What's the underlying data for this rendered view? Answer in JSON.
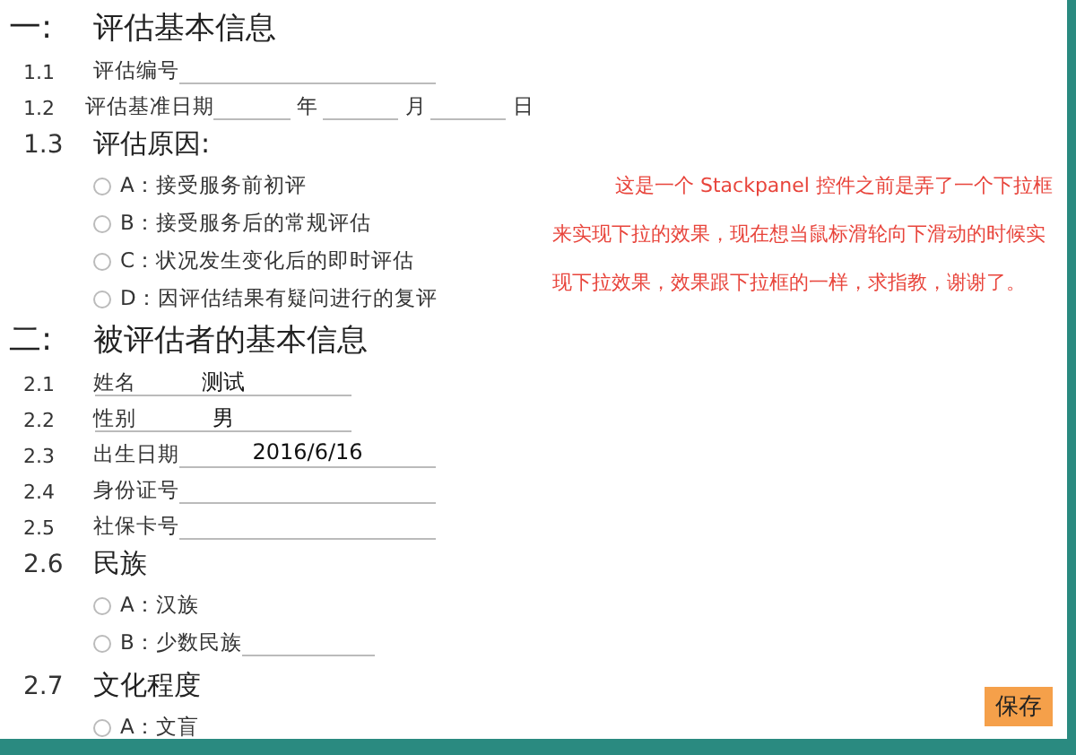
{
  "sections": [
    {
      "number": "一:",
      "title": "评估基本信息",
      "items": [
        {
          "kind": "field",
          "number": "1.1",
          "label": "评估编号"
        },
        {
          "kind": "date",
          "number": "1.2",
          "label": "评估基准日期",
          "units": [
            "年",
            "月",
            "日"
          ]
        },
        {
          "kind": "choice",
          "number": "1.3",
          "title": "评估原因:",
          "options": [
            {
              "label": "A：接受服务前初评",
              "selected": false
            },
            {
              "label": "B：接受服务后的常规评估",
              "selected": false
            },
            {
              "label": "C：状况发生变化后的即时评估",
              "selected": false
            },
            {
              "label": "D：因评估结果有疑问进行的复评",
              "selected": false
            }
          ]
        }
      ]
    },
    {
      "number": "二:",
      "title": "被评估者的基本信息",
      "items": [
        {
          "kind": "field",
          "number": "2.1",
          "label": "姓名",
          "value": "测试"
        },
        {
          "kind": "field",
          "number": "2.2",
          "label": "性别",
          "value": "男"
        },
        {
          "kind": "field",
          "number": "2.3",
          "label": "出生日期",
          "value": "2016/6/16"
        },
        {
          "kind": "field",
          "number": "2.4",
          "label": "身份证号"
        },
        {
          "kind": "field",
          "number": "2.5",
          "label": "社保卡号"
        },
        {
          "kind": "choice",
          "number": "2.6",
          "title": "民族",
          "options": [
            {
              "label": "A：汉族",
              "selected": false
            },
            {
              "label": "B：少数民族",
              "selected": false,
              "input": true
            }
          ]
        },
        {
          "kind": "choice",
          "number": "2.7",
          "title": "文化程度",
          "options": [
            {
              "label": "A：文盲",
              "selected": false
            }
          ]
        }
      ]
    }
  ],
  "note": "这是一个 Stackpanel 控件之前是弄了一个下拉框来实现下拉的效果，现在想当鼠标滑轮向下滑动的时候实现下拉效果，效果跟下拉框的一样，求指教，谢谢了。",
  "save_button": "保存"
}
